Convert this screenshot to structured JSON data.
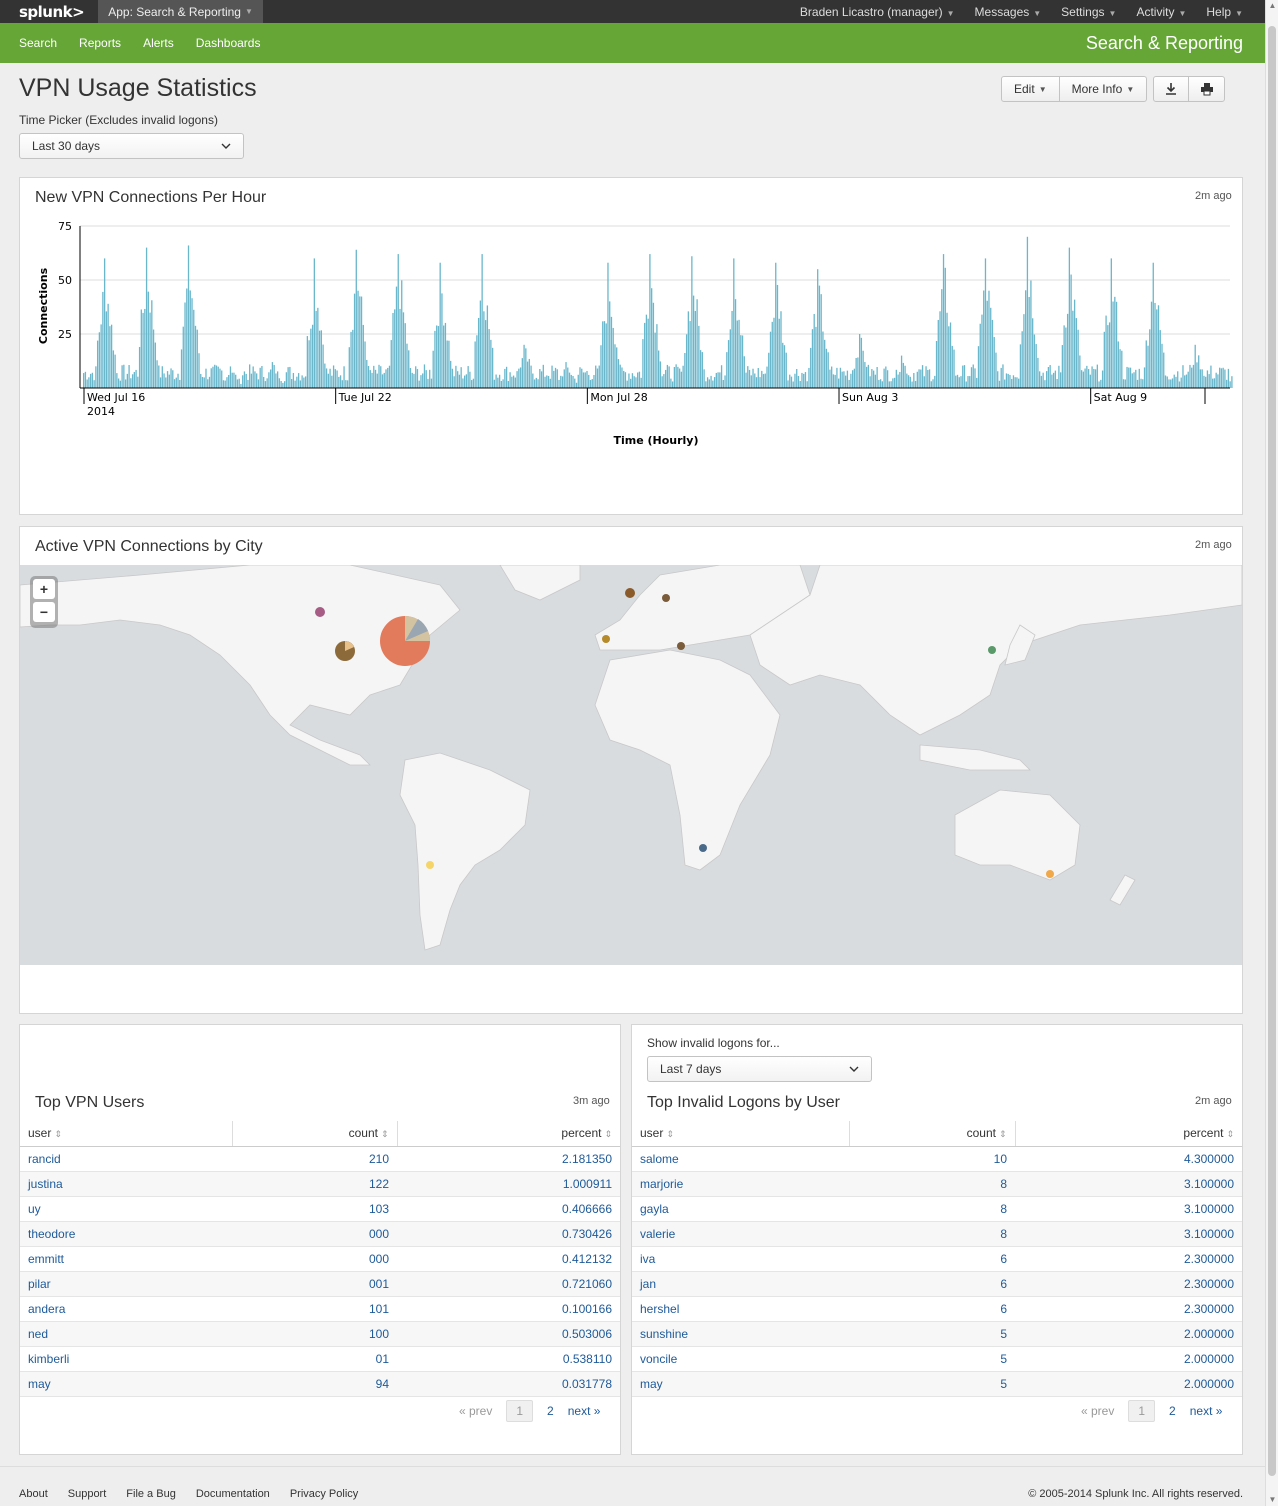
{
  "topbar": {
    "logo": "splunk>",
    "app": "App: Search & Reporting",
    "user": "Braden Licastro (manager)",
    "menus": [
      "Messages",
      "Settings",
      "Activity",
      "Help"
    ]
  },
  "appbar": {
    "nav": [
      "Search",
      "Reports",
      "Alerts",
      "Dashboards"
    ],
    "title": "Search & Reporting"
  },
  "page": {
    "title": "VPN Usage Statistics",
    "edit": "Edit",
    "more_info": "More Info",
    "time_picker_label": "Time Picker (Excludes invalid logons)",
    "time_picker_value": "Last 30 days"
  },
  "connections_panel": {
    "title": "New VPN Connections Per Hour",
    "ago": "2m ago"
  },
  "chart_data": {
    "type": "bar",
    "xlabel": "Time (Hourly)",
    "ylabel": "Connections",
    "ylim": [
      0,
      75
    ],
    "yticks": [
      25,
      50,
      75
    ],
    "xticks": [
      "Wed Jul 16",
      "Tue Jul 22",
      "Mon Jul 28",
      "Sun Aug 3",
      "Sat Aug 9"
    ],
    "xtick_sub": "2014",
    "color": "#6ab7cc",
    "days": 27,
    "daily_peaks": [
      60,
      65,
      66,
      10,
      12,
      60,
      64,
      62,
      58,
      62,
      20,
      12,
      58,
      62,
      61,
      60,
      58,
      55,
      25,
      15,
      62,
      60,
      70,
      65,
      60,
      58,
      20,
      10,
      55,
      66,
      62,
      60,
      68
    ]
  },
  "map_panel": {
    "title": "Active VPN Connections by City",
    "ago": "2m ago",
    "zoom_in": "+",
    "zoom_out": "−"
  },
  "top_users": {
    "title": "Top VPN Users",
    "ago": "3m ago",
    "columns": [
      "user",
      "count",
      "percent"
    ],
    "rows": [
      [
        "rancid",
        "210",
        "2.181350"
      ],
      [
        "justina",
        "122",
        "1.000911"
      ],
      [
        "uy",
        "103",
        "0.406666"
      ],
      [
        "theodore",
        "000",
        "0.730426"
      ],
      [
        "emmitt",
        "000",
        "0.412132"
      ],
      [
        "pilar",
        "001",
        "0.721060"
      ],
      [
        "andera",
        "101",
        "0.100166"
      ],
      [
        "ned",
        "100",
        "0.503006"
      ],
      [
        "kimberli",
        "01",
        "0.538110"
      ],
      [
        "may",
        "94",
        "0.031778"
      ]
    ],
    "pager": {
      "prev": "« prev",
      "current": "1",
      "next_page": "2",
      "next": "next »"
    }
  },
  "invalid_logons": {
    "filter_label": "Show invalid logons for...",
    "filter_value": "Last 7 days",
    "title": "Top Invalid Logons by User",
    "ago": "2m ago",
    "columns": [
      "user",
      "count",
      "percent"
    ],
    "rows": [
      [
        "salome",
        "10",
        "4.300000"
      ],
      [
        "marjorie",
        "8",
        "3.100000"
      ],
      [
        "gayla",
        "8",
        "3.100000"
      ],
      [
        "valerie",
        "8",
        "3.100000"
      ],
      [
        "iva",
        "6",
        "2.300000"
      ],
      [
        "jan",
        "6",
        "2.300000"
      ],
      [
        "hershel",
        "6",
        "2.300000"
      ],
      [
        "sunshine",
        "5",
        "2.000000"
      ],
      [
        "voncile",
        "5",
        "2.000000"
      ],
      [
        "may",
        "5",
        "2.000000"
      ]
    ],
    "pager": {
      "prev": "« prev",
      "current": "1",
      "next_page": "2",
      "next": "next »"
    }
  },
  "footer": {
    "links": [
      "About",
      "Support",
      "File a Bug",
      "Documentation",
      "Privacy Policy"
    ],
    "copyright": "© 2005-2014 Splunk Inc. All rights reserved."
  }
}
